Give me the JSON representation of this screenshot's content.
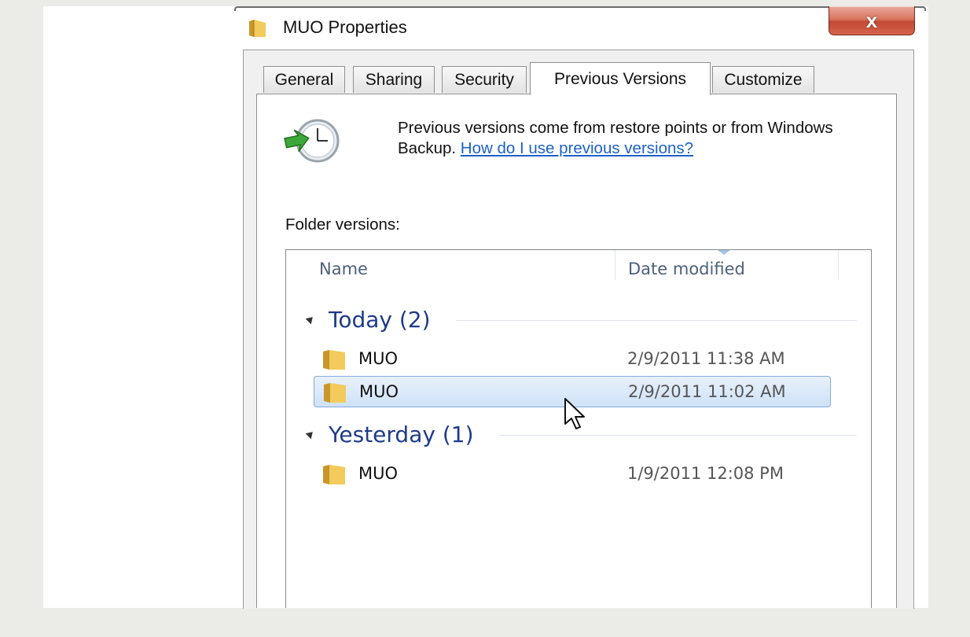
{
  "window": {
    "title": "MUO Properties",
    "close_glyph": "x"
  },
  "tabs": [
    {
      "label": "General"
    },
    {
      "label": "Sharing"
    },
    {
      "label": "Security"
    },
    {
      "label": "Previous Versions",
      "active": true
    },
    {
      "label": "Customize"
    }
  ],
  "info": {
    "text": "Previous versions come from restore points or from Windows Backup.",
    "link": "How do I use previous versions?"
  },
  "versions": {
    "label": "Folder versions:",
    "columns": {
      "name": "Name",
      "date": "Date modified"
    },
    "groups": [
      {
        "label": "Today (2)",
        "items": [
          {
            "name": "MUO",
            "date": "2/9/2011 11:38 AM",
            "selected": false
          },
          {
            "name": "MUO",
            "date": "2/9/2011 11:02 AM",
            "selected": true
          }
        ]
      },
      {
        "label": "Yesterday (1)",
        "items": [
          {
            "name": "MUO",
            "date": "1/9/2011 12:08 PM",
            "selected": false
          }
        ]
      }
    ]
  },
  "colors": {
    "link": "#1c62c8",
    "group_header": "#1e3b8a",
    "selection": "#cfe2f8"
  },
  "icons": [
    "folder-icon",
    "clock-restore-icon",
    "close-icon",
    "mouse-cursor-icon"
  ]
}
